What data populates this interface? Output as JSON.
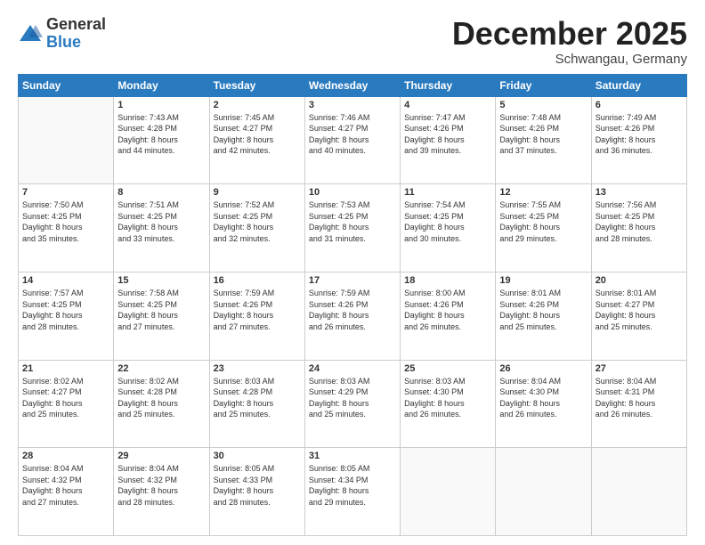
{
  "logo": {
    "general": "General",
    "blue": "Blue"
  },
  "header": {
    "month": "December 2025",
    "location": "Schwangau, Germany"
  },
  "weekdays": [
    "Sunday",
    "Monday",
    "Tuesday",
    "Wednesday",
    "Thursday",
    "Friday",
    "Saturday"
  ],
  "weeks": [
    [
      {
        "day": "",
        "info": ""
      },
      {
        "day": "1",
        "info": "Sunrise: 7:43 AM\nSunset: 4:28 PM\nDaylight: 8 hours\nand 44 minutes."
      },
      {
        "day": "2",
        "info": "Sunrise: 7:45 AM\nSunset: 4:27 PM\nDaylight: 8 hours\nand 42 minutes."
      },
      {
        "day": "3",
        "info": "Sunrise: 7:46 AM\nSunset: 4:27 PM\nDaylight: 8 hours\nand 40 minutes."
      },
      {
        "day": "4",
        "info": "Sunrise: 7:47 AM\nSunset: 4:26 PM\nDaylight: 8 hours\nand 39 minutes."
      },
      {
        "day": "5",
        "info": "Sunrise: 7:48 AM\nSunset: 4:26 PM\nDaylight: 8 hours\nand 37 minutes."
      },
      {
        "day": "6",
        "info": "Sunrise: 7:49 AM\nSunset: 4:26 PM\nDaylight: 8 hours\nand 36 minutes."
      }
    ],
    [
      {
        "day": "7",
        "info": "Sunrise: 7:50 AM\nSunset: 4:25 PM\nDaylight: 8 hours\nand 35 minutes."
      },
      {
        "day": "8",
        "info": "Sunrise: 7:51 AM\nSunset: 4:25 PM\nDaylight: 8 hours\nand 33 minutes."
      },
      {
        "day": "9",
        "info": "Sunrise: 7:52 AM\nSunset: 4:25 PM\nDaylight: 8 hours\nand 32 minutes."
      },
      {
        "day": "10",
        "info": "Sunrise: 7:53 AM\nSunset: 4:25 PM\nDaylight: 8 hours\nand 31 minutes."
      },
      {
        "day": "11",
        "info": "Sunrise: 7:54 AM\nSunset: 4:25 PM\nDaylight: 8 hours\nand 30 minutes."
      },
      {
        "day": "12",
        "info": "Sunrise: 7:55 AM\nSunset: 4:25 PM\nDaylight: 8 hours\nand 29 minutes."
      },
      {
        "day": "13",
        "info": "Sunrise: 7:56 AM\nSunset: 4:25 PM\nDaylight: 8 hours\nand 28 minutes."
      }
    ],
    [
      {
        "day": "14",
        "info": "Sunrise: 7:57 AM\nSunset: 4:25 PM\nDaylight: 8 hours\nand 28 minutes."
      },
      {
        "day": "15",
        "info": "Sunrise: 7:58 AM\nSunset: 4:25 PM\nDaylight: 8 hours\nand 27 minutes."
      },
      {
        "day": "16",
        "info": "Sunrise: 7:59 AM\nSunset: 4:26 PM\nDaylight: 8 hours\nand 27 minutes."
      },
      {
        "day": "17",
        "info": "Sunrise: 7:59 AM\nSunset: 4:26 PM\nDaylight: 8 hours\nand 26 minutes."
      },
      {
        "day": "18",
        "info": "Sunrise: 8:00 AM\nSunset: 4:26 PM\nDaylight: 8 hours\nand 26 minutes."
      },
      {
        "day": "19",
        "info": "Sunrise: 8:01 AM\nSunset: 4:26 PM\nDaylight: 8 hours\nand 25 minutes."
      },
      {
        "day": "20",
        "info": "Sunrise: 8:01 AM\nSunset: 4:27 PM\nDaylight: 8 hours\nand 25 minutes."
      }
    ],
    [
      {
        "day": "21",
        "info": "Sunrise: 8:02 AM\nSunset: 4:27 PM\nDaylight: 8 hours\nand 25 minutes."
      },
      {
        "day": "22",
        "info": "Sunrise: 8:02 AM\nSunset: 4:28 PM\nDaylight: 8 hours\nand 25 minutes."
      },
      {
        "day": "23",
        "info": "Sunrise: 8:03 AM\nSunset: 4:28 PM\nDaylight: 8 hours\nand 25 minutes."
      },
      {
        "day": "24",
        "info": "Sunrise: 8:03 AM\nSunset: 4:29 PM\nDaylight: 8 hours\nand 25 minutes."
      },
      {
        "day": "25",
        "info": "Sunrise: 8:03 AM\nSunset: 4:30 PM\nDaylight: 8 hours\nand 26 minutes."
      },
      {
        "day": "26",
        "info": "Sunrise: 8:04 AM\nSunset: 4:30 PM\nDaylight: 8 hours\nand 26 minutes."
      },
      {
        "day": "27",
        "info": "Sunrise: 8:04 AM\nSunset: 4:31 PM\nDaylight: 8 hours\nand 26 minutes."
      }
    ],
    [
      {
        "day": "28",
        "info": "Sunrise: 8:04 AM\nSunset: 4:32 PM\nDaylight: 8 hours\nand 27 minutes."
      },
      {
        "day": "29",
        "info": "Sunrise: 8:04 AM\nSunset: 4:32 PM\nDaylight: 8 hours\nand 28 minutes."
      },
      {
        "day": "30",
        "info": "Sunrise: 8:05 AM\nSunset: 4:33 PM\nDaylight: 8 hours\nand 28 minutes."
      },
      {
        "day": "31",
        "info": "Sunrise: 8:05 AM\nSunset: 4:34 PM\nDaylight: 8 hours\nand 29 minutes."
      },
      {
        "day": "",
        "info": ""
      },
      {
        "day": "",
        "info": ""
      },
      {
        "day": "",
        "info": ""
      }
    ]
  ]
}
